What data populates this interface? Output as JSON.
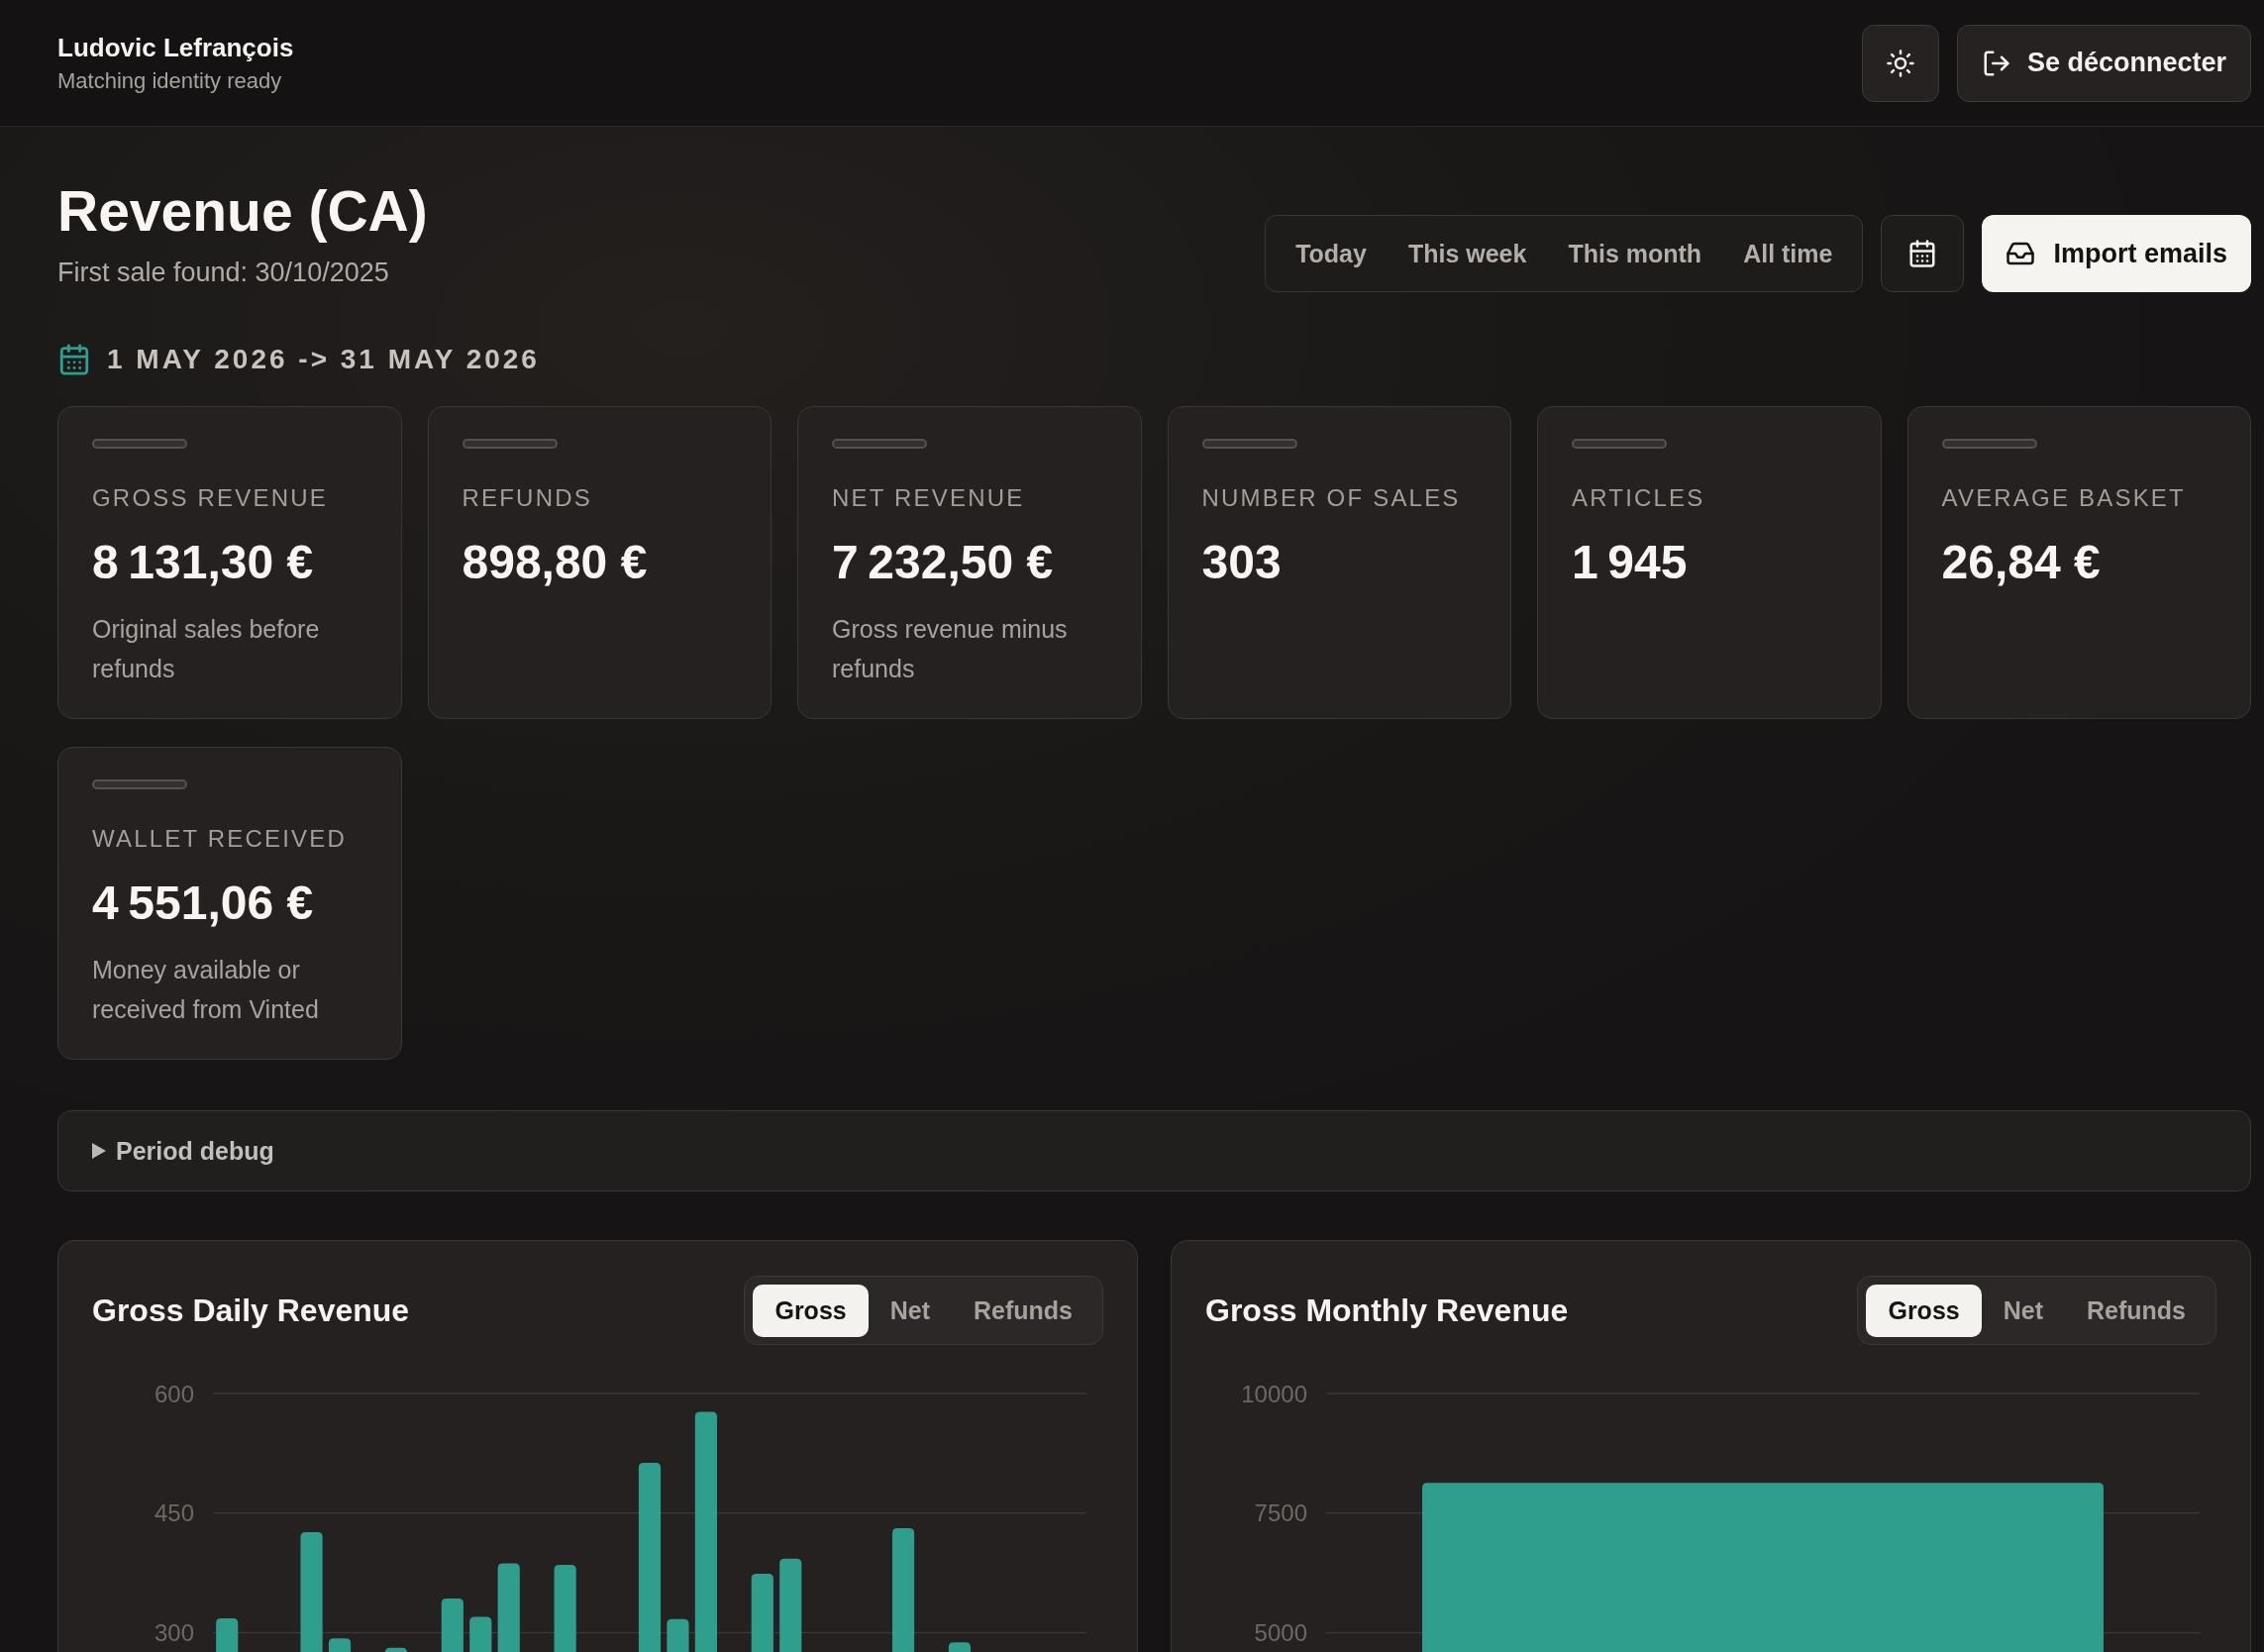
{
  "header": {
    "user_name": "Ludovic Lefrançois",
    "status": "Matching identity ready",
    "logout_button": "Se déconnecter"
  },
  "page": {
    "title": "Revenue (CA)",
    "subtitle": "First sale found: 30/10/2025"
  },
  "period_tabs": [
    {
      "label": "Today",
      "selected": false
    },
    {
      "label": "This week",
      "selected": false
    },
    {
      "label": "This month",
      "selected": false
    },
    {
      "label": "All time",
      "selected": false
    }
  ],
  "import_button": "Import emails",
  "date_range": "1 MAY 2026 -> 31 MAY 2026",
  "metrics": [
    {
      "label": "GROSS REVENUE",
      "value": "8 131,30 €",
      "description": "Original sales before refunds"
    },
    {
      "label": "REFUNDS",
      "value": "898,80 €"
    },
    {
      "label": "NET REVENUE",
      "value": "7 232,50 €",
      "description": "Gross revenue minus refunds"
    },
    {
      "label": "NUMBER OF SALES",
      "value": "303"
    },
    {
      "label": "ARTICLES",
      "value": "1 945"
    },
    {
      "label": "AVERAGE BASKET",
      "value": "26,84 €"
    },
    {
      "label": "WALLET RECEIVED",
      "value": "4 551,06 €",
      "description": "Money available or received from Vinted"
    }
  ],
  "period_debug": {
    "label": "Period debug",
    "expanded": false
  },
  "charts": [
    {
      "title": "Gross Daily Revenue",
      "modes": [
        {
          "label": "Gross",
          "selected": true
        },
        {
          "label": "Net",
          "selected": false
        },
        {
          "label": "Refunds",
          "selected": false
        }
      ],
      "chart_data": {
        "type": "bar",
        "categories": [
          null,
          null,
          null,
          null,
          null,
          null,
          null,
          null,
          null,
          null,
          null,
          null,
          null,
          null,
          null,
          null,
          null,
          null,
          null,
          null,
          null,
          null,
          null,
          null,
          null,
          null,
          null,
          null,
          null,
          null,
          null
        ],
        "values": [
          318,
          null,
          null,
          426,
          293,
          null,
          281,
          null,
          343,
          320,
          387,
          null,
          385,
          null,
          null,
          513,
          317,
          577,
          null,
          374,
          393,
          null,
          null,
          null,
          431,
          null,
          288,
          null,
          null,
          null,
          null
        ],
        "ylim": [
          0,
          600
        ],
        "yticks": [
          300,
          450,
          600
        ]
      }
    },
    {
      "title": "Gross Monthly Revenue",
      "modes": [
        {
          "label": "Gross",
          "selected": true
        },
        {
          "label": "Net",
          "selected": false
        },
        {
          "label": "Refunds",
          "selected": false
        }
      ],
      "chart_data": {
        "type": "bar",
        "categories": [
          null
        ],
        "values": [
          8130
        ],
        "ylim": [
          0,
          10000
        ],
        "yticks": [
          5000,
          7500,
          10000
        ]
      }
    }
  ]
}
